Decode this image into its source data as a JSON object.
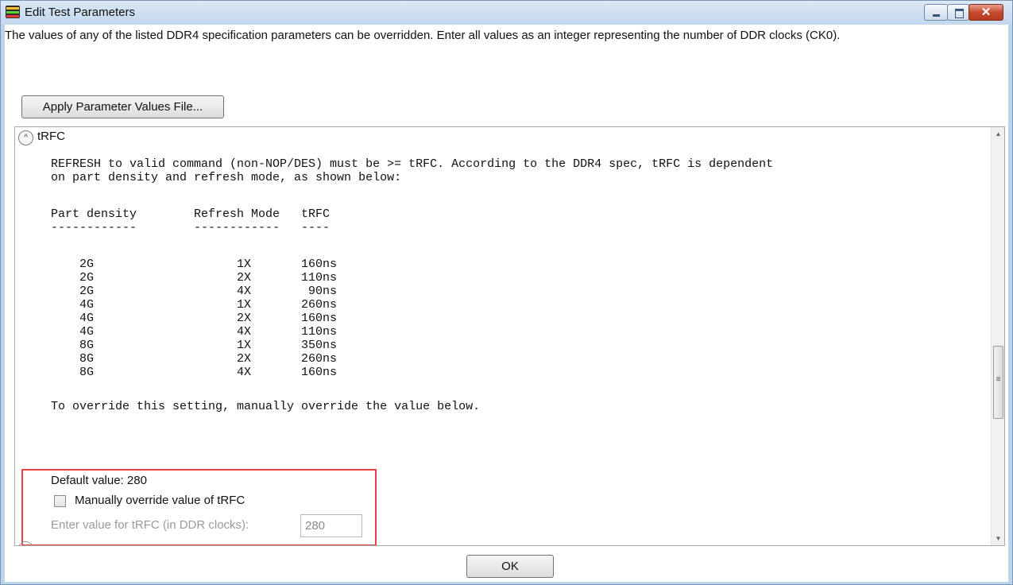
{
  "window": {
    "title": "Edit Test Parameters",
    "close_glyph": "✕"
  },
  "description": "The values of any of the listed DDR4 specification parameters can be overridden. Enter all values as an integer representing the number of DDR clocks (CK0).",
  "apply_button_label": "Apply Parameter Values File...",
  "section": {
    "expander_glyph": "^",
    "title": "tRFC",
    "description_lines": [
      "REFRESH to valid command (non-NOP/DES) must be >= tRFC. According to the DDR4 spec, tRFC is dependent",
      "on part density and refresh mode, as shown below:"
    ],
    "table_header": "Part density        Refresh Mode   tRFC",
    "table_rule": "------------        ------------   ----",
    "table_rows": [
      "    2G                    1X       160ns",
      "    2G                    2X       110ns",
      "    2G                    4X        90ns",
      "    4G                    1X       260ns",
      "    4G                    2X       160ns",
      "    4G                    4X       110ns",
      "    8G                    1X       350ns",
      "    8G                    2X       260ns",
      "    8G                    4X       160ns"
    ],
    "override_note": "To override this setting, manually override the value below.",
    "default_value_label": "Default value: 280",
    "override_checkbox_label": "Manually override value of tRFC",
    "override_checked": false,
    "input_label": "Enter value for tRFC (in DDR clocks):",
    "input_value": "280"
  },
  "scrollbar": {
    "up_glyph": "▲",
    "down_glyph": "▼",
    "grip_glyph": "≡"
  },
  "ok_button_label": "OK",
  "colors": {
    "highlight_box": "#e84545",
    "disabled_text": "#9a9a9a"
  }
}
